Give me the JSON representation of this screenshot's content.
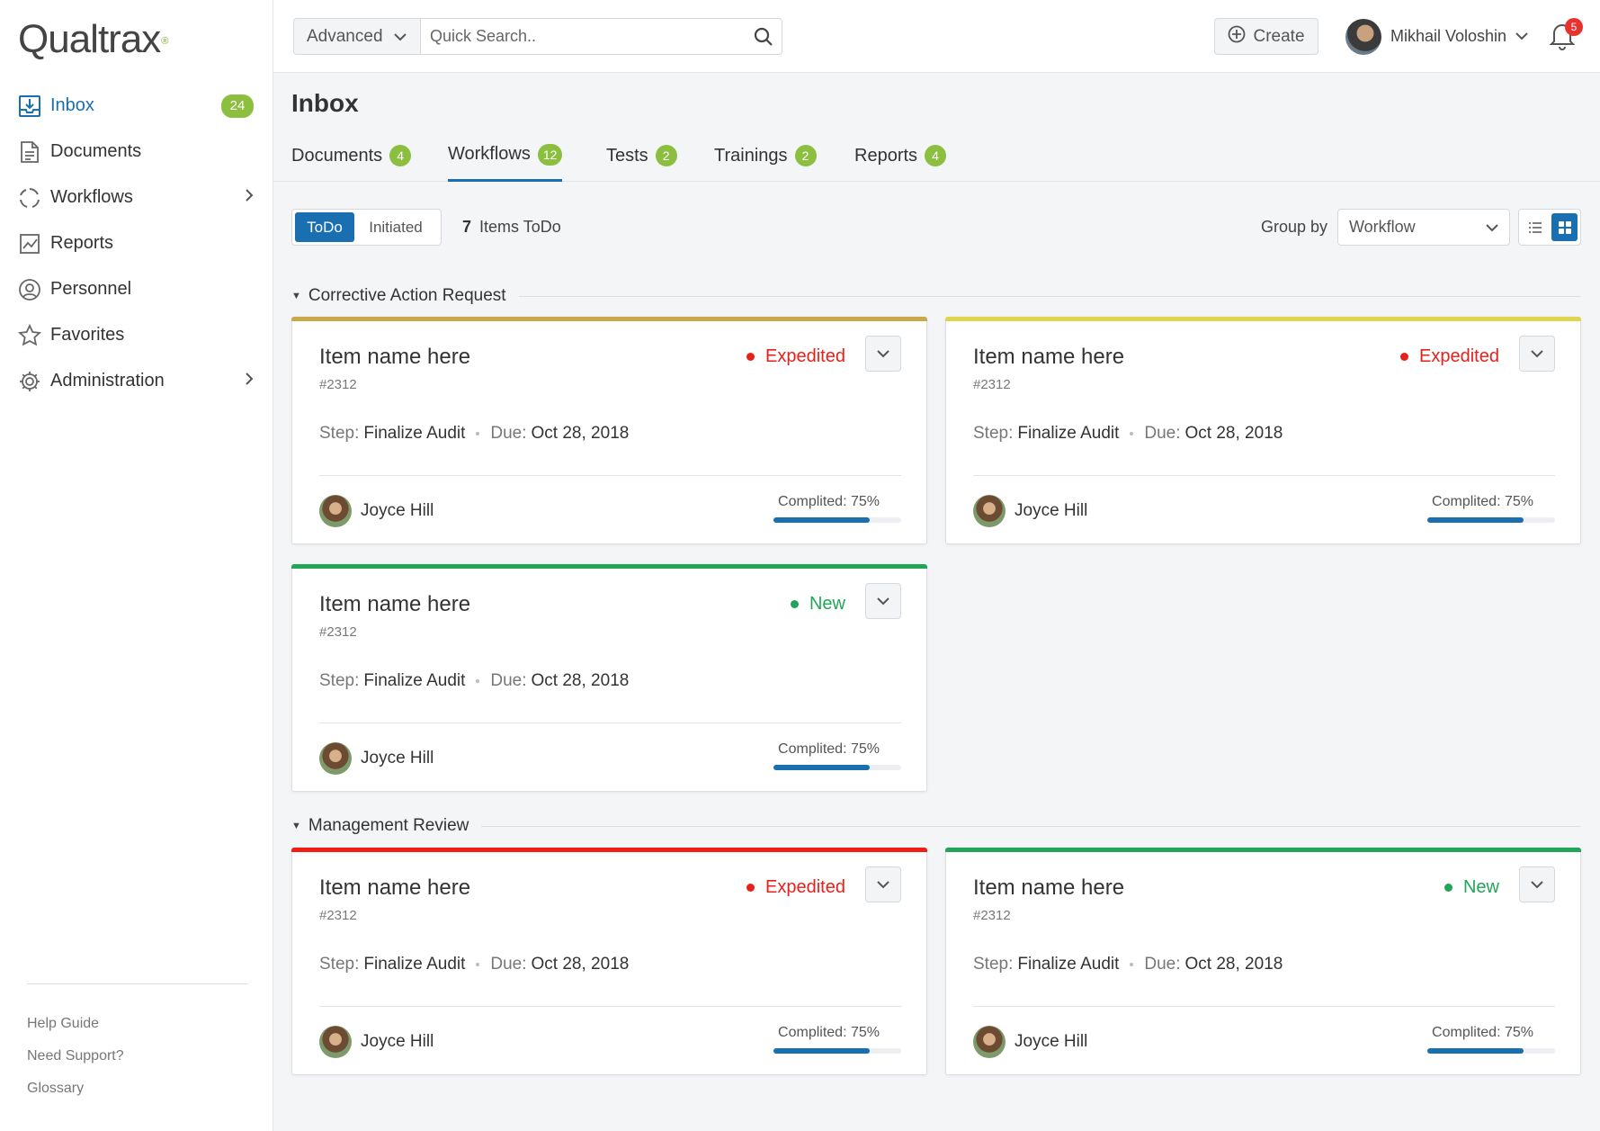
{
  "brand": {
    "logo_main": "Qualtrax",
    "logo_reg": "®"
  },
  "sidebar": {
    "items": [
      {
        "label": "Inbox",
        "icon": "inbox-icon",
        "badge": "24",
        "active": true
      },
      {
        "label": "Documents",
        "icon": "document-icon"
      },
      {
        "label": "Workflows",
        "icon": "workflow-icon",
        "has_submenu": true
      },
      {
        "label": "Reports",
        "icon": "chart-icon"
      },
      {
        "label": "Personnel",
        "icon": "person-icon"
      },
      {
        "label": "Favorites",
        "icon": "star-icon"
      },
      {
        "label": "Administration",
        "icon": "gear-icon",
        "has_submenu": true
      }
    ],
    "footer_links": [
      "Help Guide",
      "Need Support?",
      "Glossary"
    ]
  },
  "topbar": {
    "search_mode": "Advanced",
    "search_placeholder": "Quick Search..",
    "create_label": "Create",
    "user_name": "Mikhail Voloshin",
    "notification_count": "5"
  },
  "page": {
    "title": "Inbox",
    "tabs": [
      {
        "label": "Documents",
        "count": "4"
      },
      {
        "label": "Workflows",
        "count": "12",
        "active": true
      },
      {
        "label": "Tests",
        "count": "2"
      },
      {
        "label": "Trainings",
        "count": "2"
      },
      {
        "label": "Reports",
        "count": "4"
      }
    ],
    "filter": {
      "todo": "ToDo",
      "initiated": "Initiated",
      "count": "7",
      "count_label": "Items ToDo"
    },
    "group_by_label": "Group by",
    "group_by_value": "Workflow"
  },
  "groups": [
    {
      "name": "Corrective Action Request",
      "cards": [
        {
          "title": "Item name here",
          "number": "#2312",
          "status": "Expedited",
          "status_color": "#e8201a",
          "bar_color": "#c9a84a",
          "step_label": "Step:",
          "step": "Finalize Audit",
          "due_label": "Due:",
          "due": "Oct 28, 2018",
          "assignee": "Joyce Hill",
          "progress_label": "Complited: 75%",
          "progress": 0.75
        },
        {
          "title": "Item name here",
          "number": "#2312",
          "status": "Expedited",
          "status_color": "#e8201a",
          "bar_color": "#dfd54a",
          "step_label": "Step:",
          "step": "Finalize Audit",
          "due_label": "Due:",
          "due": "Oct 28, 2018",
          "assignee": "Joyce Hill",
          "progress_label": "Complited: 75%",
          "progress": 0.75
        },
        {
          "title": "Item name here",
          "number": "#2312",
          "status": "New",
          "status_color": "#21a558",
          "bar_color": "#21a558",
          "step_label": "Step:",
          "step": "Finalize Audit",
          "due_label": "Due:",
          "due": "Oct 28, 2018",
          "assignee": "Joyce Hill",
          "progress_label": "Complited: 75%",
          "progress": 0.75
        }
      ]
    },
    {
      "name": "Management Review",
      "cards": [
        {
          "title": "Item name here",
          "number": "#2312",
          "status": "Expedited",
          "status_color": "#e8201a",
          "bar_color": "#f01e14",
          "step_label": "Step:",
          "step": "Finalize Audit",
          "due_label": "Due:",
          "due": "Oct 28, 2018",
          "assignee": "Joyce Hill",
          "progress_label": "Complited: 75%",
          "progress": 0.75
        },
        {
          "title": "Item name here",
          "number": "#2312",
          "status": "New",
          "status_color": "#21a558",
          "bar_color": "#21a558",
          "step_label": "Step:",
          "step": "Finalize Audit",
          "due_label": "Due:",
          "due": "Oct 28, 2018",
          "assignee": "Joyce Hill",
          "progress_label": "Complited: 75%",
          "progress": 0.75
        }
      ]
    }
  ],
  "colors": {
    "accent": "#1a6fb0",
    "badge_green": "#8cbf3f"
  }
}
